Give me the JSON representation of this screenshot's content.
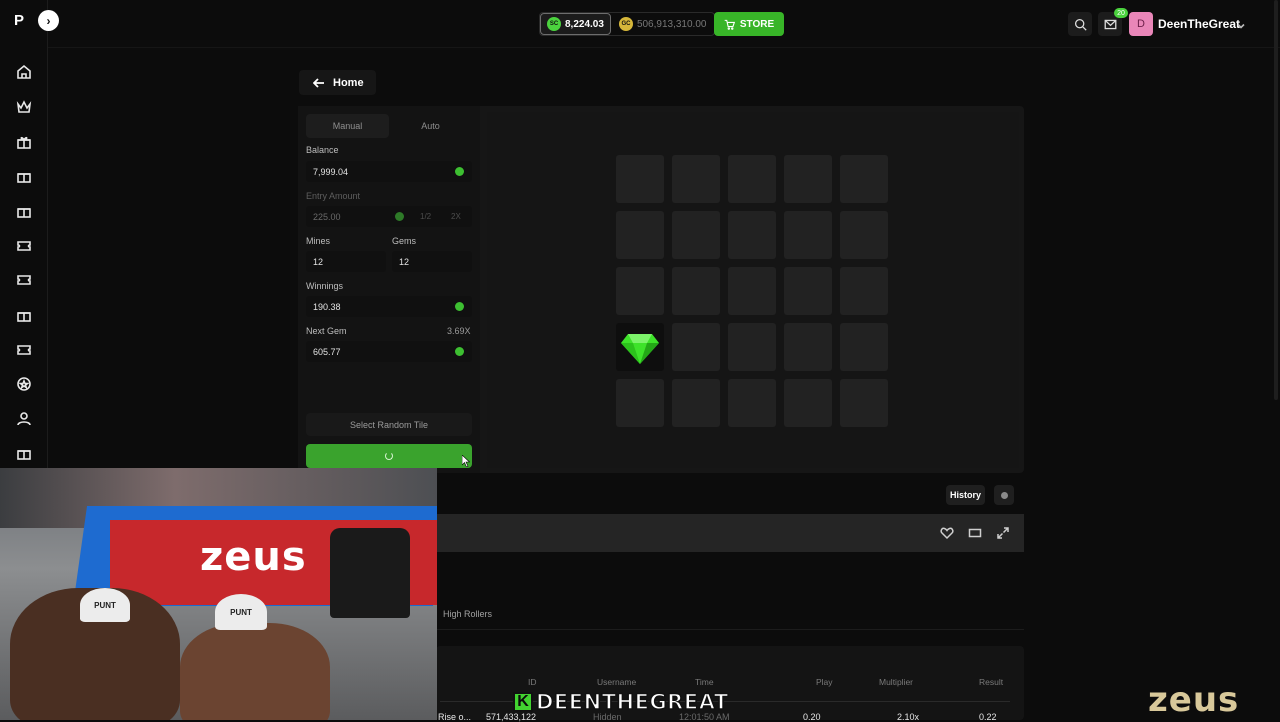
{
  "header": {
    "sc_badge": "SC",
    "sc_balance": "8,224.03",
    "gc_badge": "GC",
    "gc_balance": "506,913,310.00",
    "store_label": "STORE",
    "notification_count": "20",
    "avatar_initial": "D",
    "username": "DeenTheGreat"
  },
  "sidebar": {
    "logo": "P",
    "icons": [
      "home-icon",
      "crown-icon",
      "gift-icon",
      "gift-icon",
      "gift-icon",
      "ticket-icon",
      "ticket-icon",
      "gift-icon",
      "ticket-icon",
      "star-badge-icon",
      "user-icon",
      "gift-icon"
    ]
  },
  "nav": {
    "home_label": "Home"
  },
  "controls": {
    "tabs": [
      "Manual",
      "Auto"
    ],
    "active_tab": "Manual",
    "balance_label": "Balance",
    "balance_value": "7,999.04",
    "entry_label": "Entry Amount",
    "entry_value": "225.00",
    "half_label": "1/2",
    "double_label": "2X",
    "mines_label": "Mines",
    "mines_value": "12",
    "gems_label": "Gems",
    "gems_value": "12",
    "winnings_label": "Winnings",
    "winnings_value": "190.38",
    "next_gem_label": "Next Gem",
    "next_gem_multiplier": "3.69X",
    "next_gem_value": "605.77",
    "random_tile_label": "Select Random Tile"
  },
  "board": {
    "rows": 5,
    "cols": 5,
    "revealed_gems": [
      {
        "row": 4,
        "col": 1
      }
    ]
  },
  "below_game": {
    "history_label": "History",
    "high_rollers_label": "High Rollers"
  },
  "bets_table": {
    "headers": [
      "ID",
      "Username",
      "Time",
      "Play",
      "Multiplier",
      "Result"
    ],
    "first_row": {
      "game": "Rise o...",
      "id": "571,433,122",
      "username": "Hidden",
      "time": "12:01:50 AM",
      "play": "0.20",
      "multiplier": "2.10x",
      "result": "0.22"
    }
  },
  "overlay": {
    "streamer_badge": "K",
    "streamer_name": "DEENTHEGREAT",
    "watermark": "zeus",
    "webcam_logo_1": "zeus",
    "webcam_cap": "PUNT"
  },
  "colors": {
    "accent_green": "#38b528",
    "gem_green": "#3ee32a",
    "avatar_pink": "#e986b8"
  }
}
